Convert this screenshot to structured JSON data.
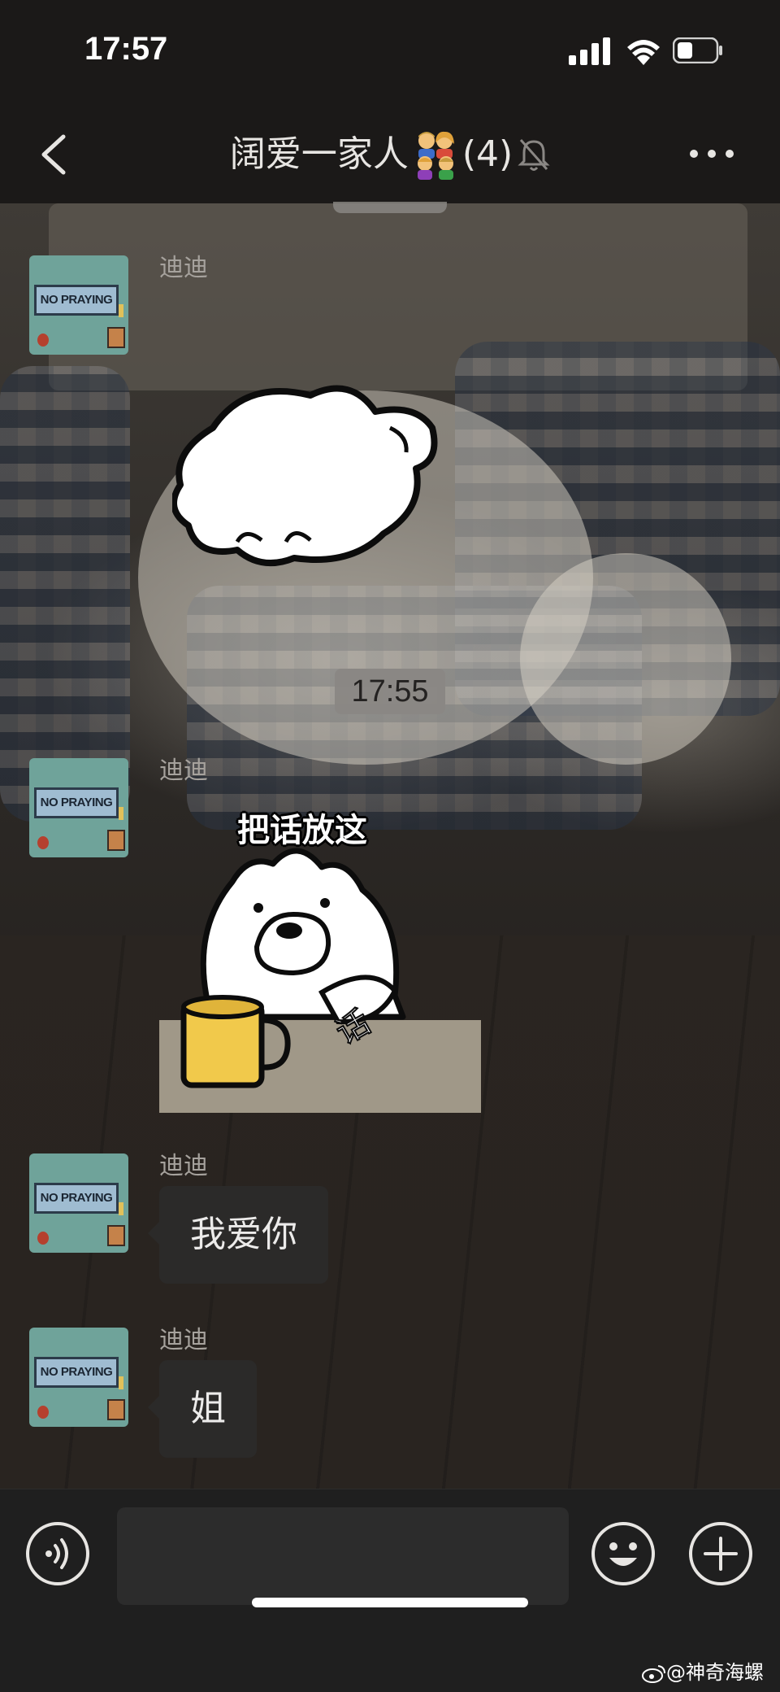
{
  "status_bar": {
    "time": "17:57"
  },
  "nav": {
    "back_icon": "chevron-left-icon",
    "title": "阔爱一家人",
    "title_emoji": "family-emoji",
    "member_count": "(4)",
    "mute_icon": "bell-slash-icon",
    "more_icon": "more-dots-icon"
  },
  "chat": {
    "avatar_text": "NO PRAYING",
    "timestamp": "17:55",
    "messages": [
      {
        "sender": "迪迪",
        "type": "sticker",
        "sticker": "white-bear-blob"
      },
      {
        "sender": "迪迪",
        "type": "sticker",
        "caption": "把话放这",
        "sticker_text": "话"
      },
      {
        "sender": "迪迪",
        "type": "text",
        "text": "我爱你"
      },
      {
        "sender": "迪迪",
        "type": "text",
        "text": "姐"
      }
    ]
  },
  "input_bar": {
    "voice_icon": "voice-icon",
    "emoji_icon": "smile-emoji-icon",
    "plus_icon": "plus-icon",
    "placeholder": ""
  },
  "watermark": "@神奇海螺",
  "colors": {
    "background": "#1b1918",
    "bubble": "#2b2a29",
    "avatar": "#6fa39a"
  }
}
